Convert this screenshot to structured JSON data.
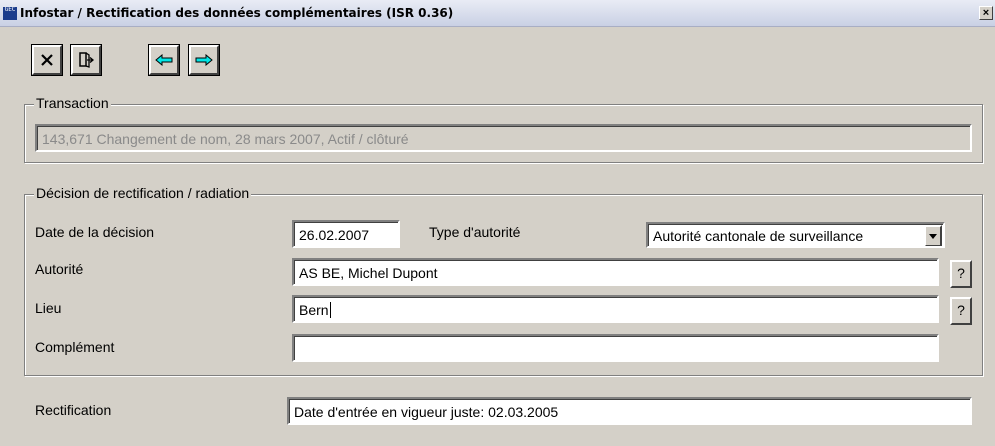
{
  "window": {
    "title": "Infostar / Rectification des données complémentaires (ISR 0.36)",
    "close_label": "×",
    "app_icon_text": "GEC"
  },
  "toolbar": {
    "buttons": [
      {
        "name": "cancel",
        "icon": "close-x-icon"
      },
      {
        "name": "exit",
        "icon": "door-exit-icon"
      },
      {
        "name": "previous",
        "icon": "arrow-left-icon",
        "color": "#00e6e6"
      },
      {
        "name": "next",
        "icon": "arrow-right-icon",
        "color": "#00e6e6"
      }
    ]
  },
  "transaction": {
    "legend": "Transaction",
    "value": "143,671  Changement de nom, 28 mars 2007, Actif / clôturé"
  },
  "decision": {
    "legend": "Décision de rectification / radiation",
    "date_label": "Date de la décision",
    "date_value": "26.02.2007",
    "authority_type_label": "Type d'autorité",
    "authority_type_value": "Autorité cantonale de surveillance",
    "authority_label": "Autorité",
    "authority_value": "AS BE, Michel Dupont",
    "place_label": "Lieu",
    "place_value": "Bern",
    "complement_label": "Complément",
    "complement_value": "",
    "lookup_label": "?"
  },
  "rectification": {
    "label": "Rectification",
    "value": "Date d'entrée en vigueur juste: 02.03.2005"
  }
}
